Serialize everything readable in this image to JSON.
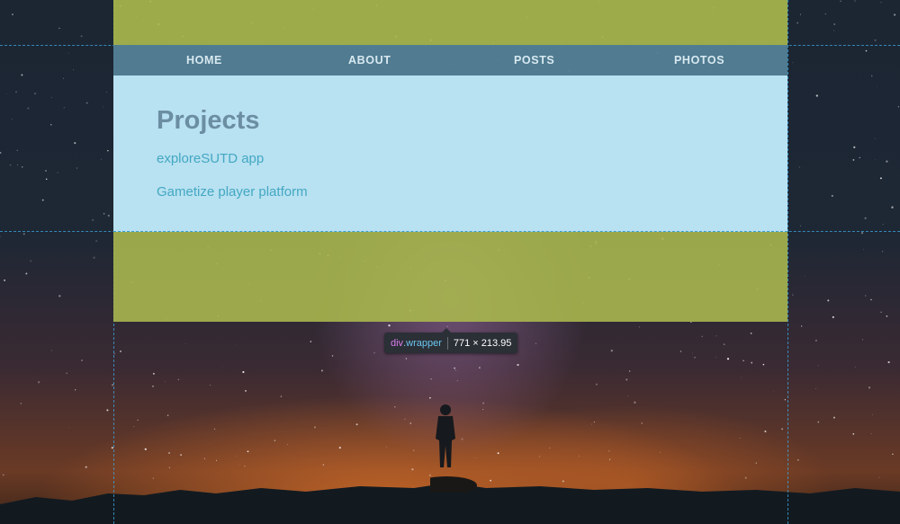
{
  "nav": {
    "items": [
      {
        "label": "HOME"
      },
      {
        "label": "ABOUT"
      },
      {
        "label": "POSTS"
      },
      {
        "label": "PHOTOS"
      }
    ]
  },
  "main": {
    "title": "Projects",
    "links": [
      {
        "label": "exploreSUTD app"
      },
      {
        "label": "Gametize player platform"
      }
    ]
  },
  "inspector": {
    "tag": "div",
    "class_name": ".wrapper",
    "size": "771 × 213.95"
  },
  "colors": {
    "highlight_margin": "#a8b64e",
    "highlight_content": "#b8e1f1",
    "nav_bg": "#538096",
    "guide": "#3aa0d8"
  }
}
